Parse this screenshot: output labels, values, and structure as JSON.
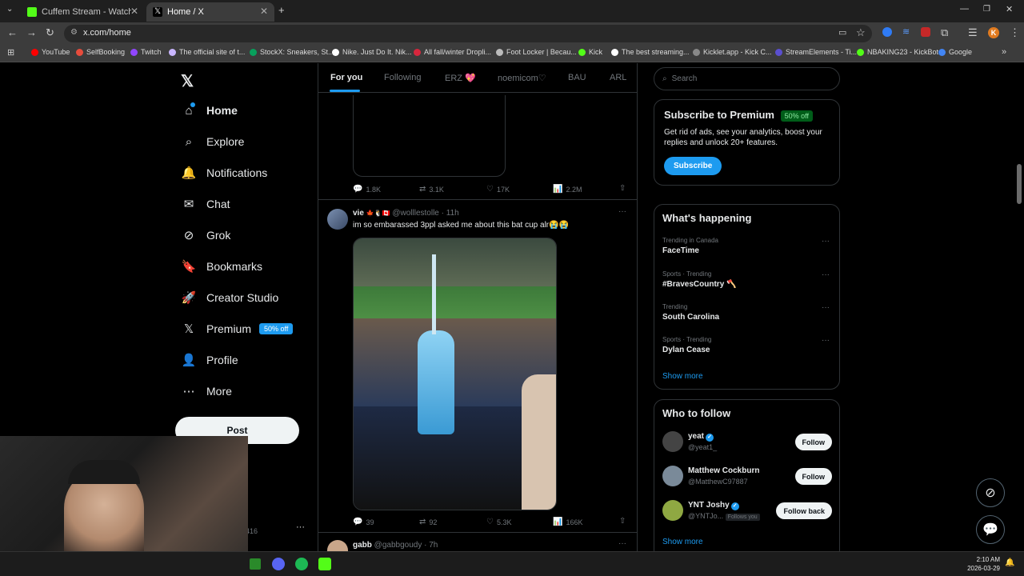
{
  "browser": {
    "tabs": [
      {
        "title": "Cuffem Stream - Watch Live on",
        "favicon_color": "#53fc18",
        "active": false
      },
      {
        "title": "Home / X",
        "favicon_color": "#000000",
        "active": true
      }
    ],
    "url": "x.com/home",
    "bookmarks": [
      {
        "label": "YouTube",
        "color": "#ff0000"
      },
      {
        "label": "SelfBooking",
        "color": "#e74c3c"
      },
      {
        "label": "Twitch",
        "color": "#9146ff"
      },
      {
        "label": "The official site of t...",
        "color": "#c9b6ff"
      },
      {
        "label": "StockX: Sneakers, St...",
        "color": "#08a05c"
      },
      {
        "label": "Nike. Just Do It. Nik...",
        "color": "#ffffff"
      },
      {
        "label": "All fall/winter Dropli...",
        "color": "#d7263d"
      },
      {
        "label": "Foot Locker | Becau...",
        "color": "#bbbbbb"
      },
      {
        "label": "Kick",
        "color": "#53fc18"
      },
      {
        "label": "The best streaming...",
        "color": "#ffffff"
      },
      {
        "label": "Kicklet.app - Kick C...",
        "color": "#888888"
      },
      {
        "label": "StreamElements - Ti...",
        "color": "#5a4fcf"
      },
      {
        "label": "NBAKING23 - KickBot",
        "color": "#53fc18"
      },
      {
        "label": "Google",
        "color": "#4285f4"
      }
    ]
  },
  "sidebar": {
    "items": [
      {
        "label": "Home",
        "icon": "house-icon",
        "glyph": "⌂"
      },
      {
        "label": "Explore",
        "icon": "search-icon",
        "glyph": "⌕"
      },
      {
        "label": "Notifications",
        "icon": "bell-icon",
        "glyph": "🔔"
      },
      {
        "label": "Chat",
        "icon": "envelope-icon",
        "glyph": "✉"
      },
      {
        "label": "Grok",
        "icon": "grok-icon",
        "glyph": "⊘"
      },
      {
        "label": "Bookmarks",
        "icon": "bookmark-icon",
        "glyph": "🔖"
      },
      {
        "label": "Creator Studio",
        "icon": "rocket-icon",
        "glyph": "🚀"
      },
      {
        "label": "Premium",
        "icon": "x-logo-icon",
        "glyph": "𝕏"
      },
      {
        "label": "Profile",
        "icon": "person-icon",
        "glyph": "👤"
      },
      {
        "label": "More",
        "icon": "more-circle-icon",
        "glyph": "⋯"
      }
    ],
    "premium_badge": "50% off",
    "post_label": "Post",
    "account_fragment": "416",
    "account_more": "···"
  },
  "feed": {
    "tabs": [
      "For you",
      "Following",
      "ERZ 💖",
      "noemicom♡",
      "BAU",
      "ARL"
    ],
    "prev_post_metrics": {
      "replies": "1.8K",
      "reposts": "3.1K",
      "likes": "17K",
      "views": "2.2M"
    },
    "post": {
      "name": "vie",
      "emojis": "🍁🐧🇨🇦",
      "handle": "@wolllestolle",
      "time": "· 11h",
      "text": "im so embarassed 3ppl asked me about this bat cup alr😭😭",
      "metrics": {
        "replies": "39",
        "reposts": "92",
        "likes": "5.3K",
        "views": "166K"
      }
    },
    "next_post": {
      "name": "gabb",
      "handle": "@gabbgoudy",
      "time": "· 7h"
    }
  },
  "right": {
    "search_placeholder": "Search",
    "premium": {
      "title": "Subscribe to Premium",
      "badge": "50% off",
      "body": "Get rid of ads, see your analytics, boost your replies and unlock 20+ features.",
      "button": "Subscribe"
    },
    "happening": {
      "title": "What's happening",
      "trends": [
        {
          "meta": "Trending in Canada",
          "name": "FaceTime"
        },
        {
          "meta": "Sports · Trending",
          "name": "#BravesCountry 🪓"
        },
        {
          "meta": "Trending",
          "name": "South Carolina"
        },
        {
          "meta": "Sports · Trending",
          "name": "Dylan Cease"
        }
      ],
      "show_more": "Show more"
    },
    "who_to_follow": {
      "title": "Who to follow",
      "accounts": [
        {
          "name": "yeat",
          "handle": "@yeat1_",
          "verified": true,
          "button": "Follow",
          "follows_you": "",
          "avatar_color": "#444444"
        },
        {
          "name": "Matthew Cockburn",
          "handle": "@MatthewC97887",
          "verified": false,
          "button": "Follow",
          "follows_you": "",
          "avatar_color": "#7a8a99"
        },
        {
          "name": "YNT Joshy",
          "handle": "@YNTJo...",
          "verified": true,
          "button": "Follow back",
          "follows_you": "Follows you",
          "avatar_color": "#8fa842"
        }
      ],
      "show_more": "Show more"
    }
  },
  "taskbar": {
    "time": "2:10 AM",
    "date": "2026-03-29"
  },
  "colors": {
    "accent": "#1d9bf0",
    "background": "#000000",
    "border": "#2f3336",
    "muted": "#71767b"
  }
}
